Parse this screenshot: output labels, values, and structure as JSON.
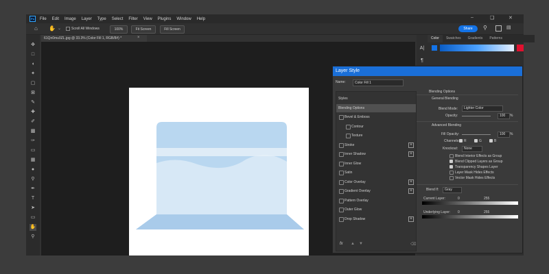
{
  "menubar": {
    "logo": "Ps",
    "items": [
      "File",
      "Edit",
      "Image",
      "Layer",
      "Type",
      "Select",
      "Filter",
      "View",
      "Plugins",
      "Window",
      "Help"
    ]
  },
  "options_bar": {
    "scroll_all_windows": "Scroll All Windows",
    "zoom": "100%",
    "fit_screen": "Fit Screen",
    "fill_screen": "Fill Screen",
    "share": "Share"
  },
  "document": {
    "tab_title": "61Qn0mu0ZL.jpg @ 33.3% (Color Fill 1, RGB/8#) *"
  },
  "panels": {
    "tabs": [
      "Color",
      "Swatches",
      "Gradients",
      "Patterns"
    ]
  },
  "dialog": {
    "title": "Layer Style",
    "name_label": "Name:",
    "name_value": "Color Fill 1",
    "styles": [
      {
        "label": "Styles",
        "checkbox": false,
        "plus": false,
        "indent": false,
        "selected": false
      },
      {
        "label": "Blending Options",
        "checkbox": false,
        "plus": false,
        "indent": false,
        "selected": true
      },
      {
        "label": "Bevel & Emboss",
        "checkbox": true,
        "plus": false,
        "indent": false,
        "selected": false
      },
      {
        "label": "Contour",
        "checkbox": true,
        "plus": false,
        "indent": true,
        "selected": false
      },
      {
        "label": "Texture",
        "checkbox": true,
        "plus": false,
        "indent": true,
        "selected": false
      },
      {
        "label": "Stroke",
        "checkbox": true,
        "plus": true,
        "indent": false,
        "selected": false
      },
      {
        "label": "Inner Shadow",
        "checkbox": true,
        "plus": true,
        "indent": false,
        "selected": false
      },
      {
        "label": "Inner Glow",
        "checkbox": true,
        "plus": false,
        "indent": false,
        "selected": false
      },
      {
        "label": "Satin",
        "checkbox": true,
        "plus": false,
        "indent": false,
        "selected": false
      },
      {
        "label": "Color Overlay",
        "checkbox": true,
        "plus": true,
        "indent": false,
        "selected": false
      },
      {
        "label": "Gradient Overlay",
        "checkbox": true,
        "plus": true,
        "indent": false,
        "selected": false
      },
      {
        "label": "Pattern Overlay",
        "checkbox": true,
        "plus": false,
        "indent": false,
        "selected": false
      },
      {
        "label": "Outer Glow",
        "checkbox": true,
        "plus": false,
        "indent": false,
        "selected": false
      },
      {
        "label": "Drop Shadow",
        "checkbox": true,
        "plus": true,
        "indent": false,
        "selected": false
      }
    ],
    "fx_label": "fx",
    "blending": {
      "section": "Blending Options",
      "general": "General Blending",
      "blend_mode_label": "Blend Mode:",
      "blend_mode_value": "Lighter Color",
      "opacity_label": "Opacity:",
      "opacity_value": "100",
      "advanced": "Advanced Blending",
      "fill_opacity_label": "Fill Opacity:",
      "fill_opacity_value": "100",
      "channels_label": "Channels:",
      "channel_r": "R",
      "channel_g": "G",
      "channel_b": "B",
      "knockout_label": "Knockout:",
      "knockout_value": "None",
      "options": [
        {
          "label": "Blend Interior Effects as Group",
          "checked": false
        },
        {
          "label": "Blend Clipped Layers as Group",
          "checked": true
        },
        {
          "label": "Transparency Shapes Layer",
          "checked": true
        },
        {
          "label": "Layer Mask Hides Effects",
          "checked": false
        },
        {
          "label": "Vector Mask Hides Effects",
          "checked": false
        }
      ],
      "blend_if_label": "Blend If:",
      "blend_if_value": "Gray",
      "current_layer_label": "Current Layer:",
      "current_low": "0",
      "current_high": "255",
      "underlying_layer_label": "Underlying Layer:",
      "underlying_low": "0",
      "underlying_high": "255"
    }
  },
  "colors": {
    "accent": "#1473e6",
    "dialog_title": "#1a6fd8",
    "swatch_red": "#e0102f",
    "fill_blue": "#b9d7f0"
  }
}
